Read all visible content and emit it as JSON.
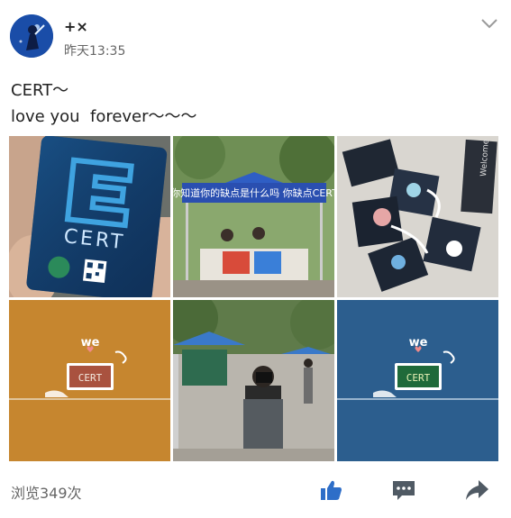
{
  "post": {
    "author": "+×",
    "timestamp": "昨天13:35",
    "text_lines": [
      "CERT～",
      "love you  forever～～～"
    ]
  },
  "images": [
    {
      "name": "cert-card-photo",
      "card_text": "CERT"
    },
    {
      "name": "booth-tent-photo",
      "banner_text": "你知道你的缺点是什么吗 你缺点CERT"
    },
    {
      "name": "stickers-photo",
      "tag_text": "Welcome"
    },
    {
      "name": "cert-we-orange",
      "we_text": "we",
      "screen_text": "CERT",
      "bg_color": "#c6862f"
    },
    {
      "name": "photographer-photo"
    },
    {
      "name": "cert-we-blue",
      "we_text": "we",
      "screen_text": "CERT",
      "bg_color": "#2c5e8e"
    }
  ],
  "footer": {
    "views_label": "浏览349次",
    "icons": [
      "like-icon",
      "comment-icon",
      "share-icon"
    ]
  },
  "colors": {
    "accent": "#2e6ec8",
    "icon_gray": "#505a64",
    "secondary_text": "#666666"
  }
}
